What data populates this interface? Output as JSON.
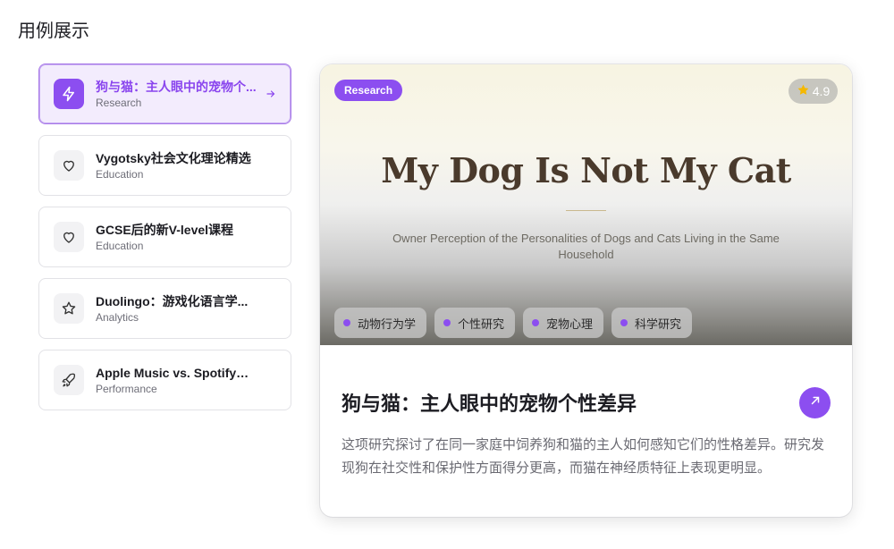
{
  "page": {
    "title": "用例展示"
  },
  "list": {
    "items": [
      {
        "title": "狗与猫：主人眼中的宠物个...",
        "category": "Research",
        "icon": "lightning-icon",
        "active": true
      },
      {
        "title": "Vygotsky社会文化理论精选",
        "category": "Education",
        "icon": "heart-icon",
        "active": false
      },
      {
        "title": "GCSE后的新V-level课程",
        "category": "Education",
        "icon": "heart-icon",
        "active": false
      },
      {
        "title": "Duolingo：游戏化语言学...",
        "category": "Analytics",
        "icon": "star-icon",
        "active": false
      },
      {
        "title": "Apple Music vs. Spotify：...",
        "category": "Performance",
        "icon": "rocket-icon",
        "active": false
      }
    ]
  },
  "card": {
    "badge": "Research",
    "rating": "4.9",
    "hero_title": "My Dog Is Not My Cat",
    "hero_subtitle": "Owner Perception of the Personalities of Dogs and Cats Living in the Same Household",
    "tags": [
      "动物行为学",
      "个性研究",
      "宠物心理",
      "科学研究"
    ],
    "title": "狗与猫：主人眼中的宠物个性差异",
    "description": "这项研究探讨了在同一家庭中饲养狗和猫的主人如何感知它们的性格差异。研究发现狗在社交性和保护性方面得分更高，而猫在神经质特征上表现更明显。"
  },
  "colors": {
    "accent": "#8c4ef0",
    "star": "#f5b800"
  }
}
